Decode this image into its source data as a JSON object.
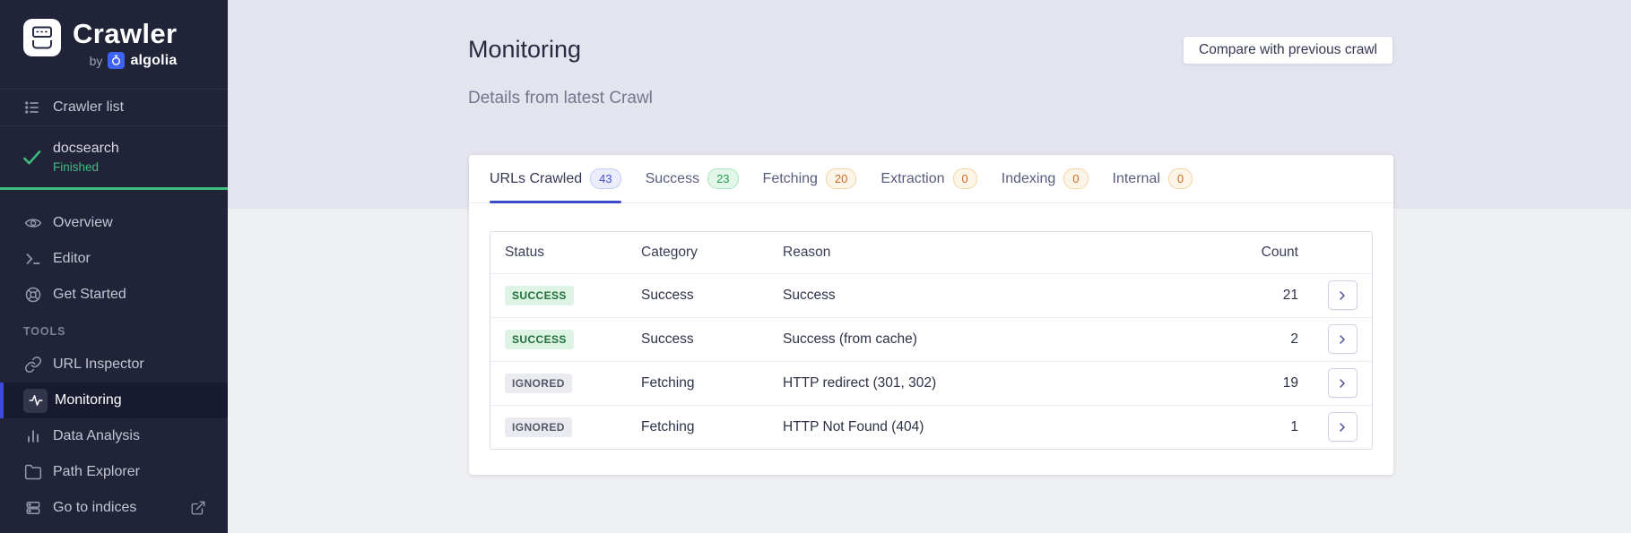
{
  "sidebar": {
    "logo": {
      "title": "Crawler",
      "by": "by",
      "brand": "algolia"
    },
    "crawler_list_label": "Crawler list",
    "crawler": {
      "name": "docsearch",
      "status": "Finished"
    },
    "nav": [
      {
        "label": "Overview",
        "icon": "eye-icon"
      },
      {
        "label": "Editor",
        "icon": "terminal-icon"
      },
      {
        "label": "Get Started",
        "icon": "lifebuoy-icon"
      }
    ],
    "tools_header": "TOOLS",
    "tools": [
      {
        "label": "URL Inspector",
        "icon": "link-icon"
      },
      {
        "label": "Monitoring",
        "icon": "activity-icon",
        "active": true
      },
      {
        "label": "Data Analysis",
        "icon": "bar-chart-icon"
      },
      {
        "label": "Path Explorer",
        "icon": "folder-icon"
      },
      {
        "label": "Go to indices",
        "icon": "indices-icon",
        "external": true
      }
    ]
  },
  "header": {
    "title": "Monitoring",
    "subtitle": "Details from latest Crawl",
    "compare_button": "Compare with previous crawl"
  },
  "tabs": [
    {
      "label": "URLs Crawled",
      "count": "43",
      "badge": "indigo",
      "active": true
    },
    {
      "label": "Success",
      "count": "23",
      "badge": "green",
      "active": false
    },
    {
      "label": "Fetching",
      "count": "20",
      "badge": "orange",
      "active": false
    },
    {
      "label": "Extraction",
      "count": "0",
      "badge": "orange",
      "active": false
    },
    {
      "label": "Indexing",
      "count": "0",
      "badge": "orange",
      "active": false
    },
    {
      "label": "Internal",
      "count": "0",
      "badge": "orange",
      "active": false
    }
  ],
  "table": {
    "columns": [
      "Status",
      "Category",
      "Reason",
      "Count"
    ],
    "rows": [
      {
        "status": "SUCCESS",
        "status_type": "success",
        "category": "Success",
        "reason": "Success",
        "count": "21"
      },
      {
        "status": "SUCCESS",
        "status_type": "success",
        "category": "Success",
        "reason": "Success (from cache)",
        "count": "2"
      },
      {
        "status": "IGNORED",
        "status_type": "ignored",
        "category": "Fetching",
        "reason": "HTTP redirect (301, 302)",
        "count": "19"
      },
      {
        "status": "IGNORED",
        "status_type": "ignored",
        "category": "Fetching",
        "reason": "HTTP Not Found (404)",
        "count": "1"
      }
    ]
  },
  "colors": {
    "sidebar_bg": "#212338",
    "active_accent": "#3d4be0",
    "tab_underline": "#3c4bc7",
    "success_green": "#3ebd7d",
    "algolia_blue": "#3e63f4",
    "band_bg": "#e3e4ed",
    "page_bg": "#eff0f2"
  }
}
